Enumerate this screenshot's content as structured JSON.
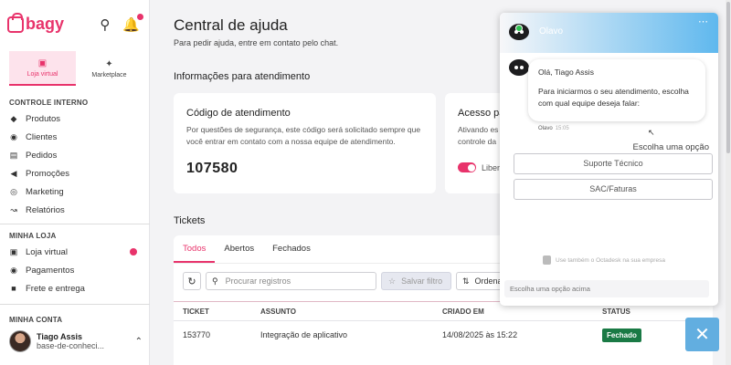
{
  "sidebar": {
    "logo": "bagy",
    "store_tabs": [
      {
        "label": "Loja virtual",
        "icon": "storefront-icon"
      },
      {
        "label": "Marketplace",
        "icon": "marketplace-icon"
      }
    ],
    "sections": [
      {
        "title": "CONTROLE INTERNO",
        "items": [
          "Produtos",
          "Clientes",
          "Pedidos",
          "Promoções",
          "Marketing",
          "Relatórios"
        ]
      },
      {
        "title": "MINHA LOJA",
        "items": [
          "Loja virtual",
          "Pagamentos",
          "Frete e entrega"
        ]
      },
      {
        "title": "MINHA CONTA"
      }
    ],
    "account": {
      "name": "Tiago Assis",
      "store": "base-de-conheci..."
    }
  },
  "main": {
    "title": "Central de ajuda",
    "subtitle": "Para pedir ajuda, entre em contato pelo chat.",
    "info_title": "Informações para atendimento",
    "card_code": {
      "title": "Código de atendimento",
      "text": "Por questões de segurança, este código será solicitado sempre que você entrar em contato com a nossa equipe de atendimento.",
      "code": "107580"
    },
    "card_access": {
      "title": "Acesso pa",
      "line1": "Ativando es",
      "line2": "controle da",
      "toggle_label": "Libera"
    },
    "tickets_title": "Tickets",
    "tabs": [
      "Todos",
      "Abertos",
      "Fechados"
    ],
    "search_placeholder": "Procurar registros",
    "save_filter": "Salvar filtro",
    "order": "Ordenar",
    "columns": [
      "TICKET",
      "ASSUNTO",
      "CRIADO EM",
      "STATUS"
    ],
    "rows": [
      {
        "ticket": "153770",
        "subject": "Integração de aplicativo",
        "created": "14/08/2025 às 15:22",
        "status": "Fechado"
      }
    ]
  },
  "chat": {
    "agent": "Olavo",
    "greeting": "Olá, Tiago Assis",
    "message": "Para iniciarmos o seu atendimento, escolha com qual equipe deseja falar:",
    "sender": "Olavo",
    "time": "15:05",
    "prompt": "Escolha uma opção",
    "options": [
      "Suporte Técnico",
      "SAC/Faturas"
    ],
    "powered_by": "Use também o Octadesk na sua empresa",
    "input_placeholder": "Escolha uma opção acima"
  },
  "colors": {
    "brand": "#e8336b",
    "chat_accent": "#5fb8ee",
    "status_closed": "#1a7a45"
  }
}
